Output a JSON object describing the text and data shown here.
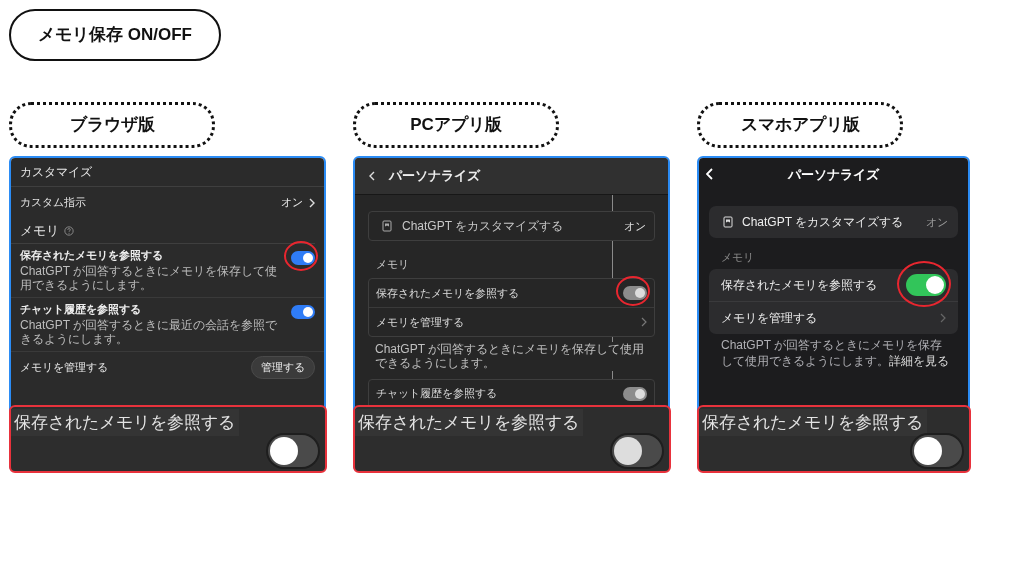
{
  "title": "メモリ保存 ON/OFF",
  "panels": [
    {
      "label": "ブラウザ版",
      "kind": "browser",
      "header": "カスタマイズ",
      "custom_row": {
        "label": "カスタム指示",
        "value": "オン"
      },
      "section": "メモリ",
      "settings": [
        {
          "label": "保存されたメモリを参照する",
          "description": "ChatGPT が回答するときにメモリを保存して使用できるようにします。",
          "on": true,
          "highlighted": true
        },
        {
          "label": "チャット履歴を参照する",
          "description": "ChatGPT が回答するときに最近の会話を参照できるようにします。",
          "on": true,
          "highlighted": false
        }
      ],
      "manage": {
        "label": "メモリを管理する",
        "button": "管理する"
      },
      "callout": {
        "label": "保存されたメモリを参照する",
        "on": false
      }
    },
    {
      "label": "PCアプリ版",
      "kind": "desktop",
      "header": "パーソナライズ",
      "custom_row": {
        "label": "ChatGPT をカスタマイズする",
        "value": "オン"
      },
      "section": "メモリ",
      "settings": [
        {
          "label": "保存されたメモリを参照する",
          "on": true,
          "highlighted": true
        }
      ],
      "manage": {
        "label": "メモリを管理する"
      },
      "description": "ChatGPT が回答するときにメモリを保存して使用できるようにします。",
      "extra_setting": {
        "label": "チャット履歴を参照する",
        "on": true
      },
      "callout": {
        "label": "保存されたメモリを参照する",
        "on": false
      }
    },
    {
      "label": "スマホアプリ版",
      "kind": "mobile",
      "header": "パーソナライズ",
      "custom_row": {
        "label": "ChatGPT をカスタマイズする",
        "value": "オン"
      },
      "section": "メモリ",
      "settings": [
        {
          "label": "保存されたメモリを参照する",
          "on": true,
          "highlighted": true
        }
      ],
      "manage": {
        "label": "メモリを管理する"
      },
      "description": "ChatGPT が回答するときにメモリを保存して使用できるようにします。",
      "link": "詳細を見る",
      "callout": {
        "label": "保存されたメモリを参照する",
        "on": false
      }
    }
  ]
}
